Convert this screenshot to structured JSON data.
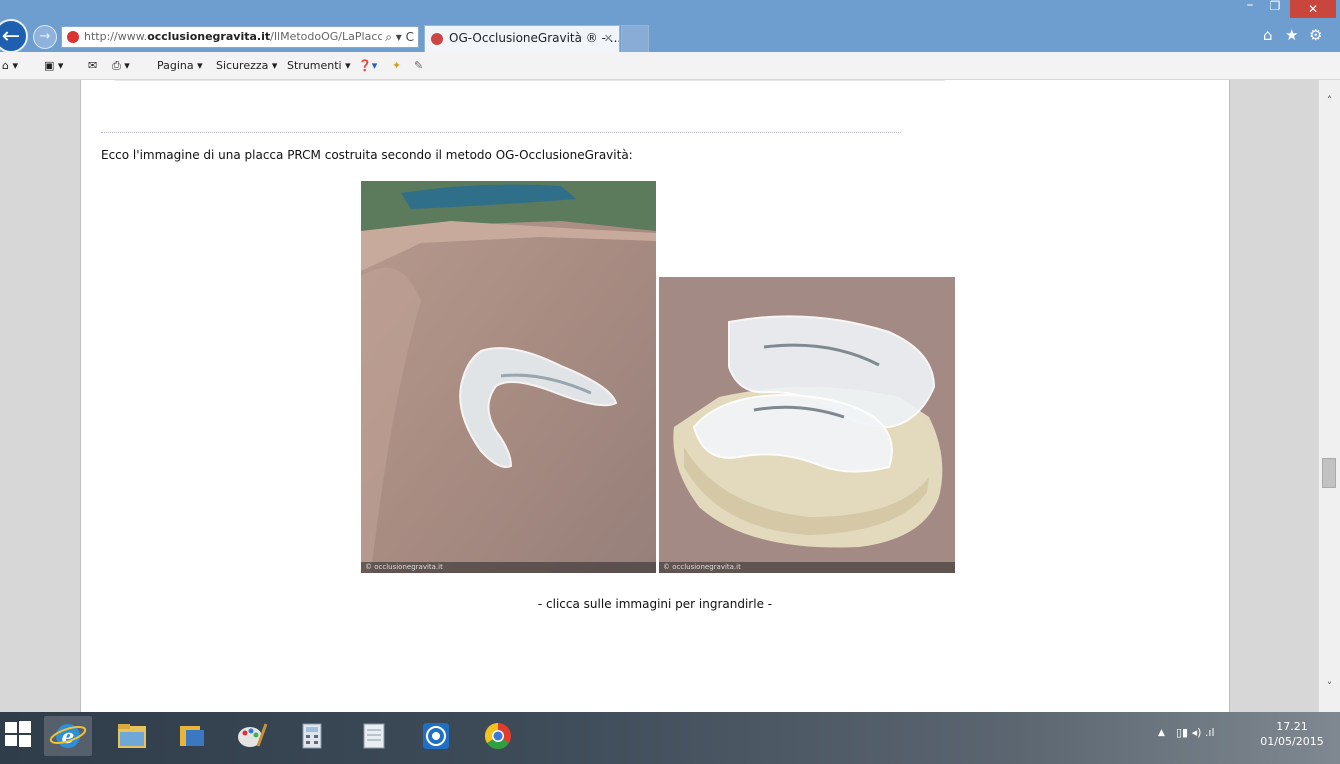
{
  "browser": {
    "address": {
      "prefix": "http://www.",
      "domain": "occlusionegravita.it",
      "path": "/IlMetodoOG/LaPlacc",
      "actions": "⌕ ▾ C"
    },
    "tab": {
      "title": "OG-OcclusioneGravità ® - ...",
      "close": "✕"
    },
    "window": {
      "minimize": "–",
      "maximize": "❐",
      "close": "✕"
    },
    "toolbar": {
      "home": "⌂ ▾",
      "feeds": "▣ ▾",
      "mail": "✉",
      "print": "⎙ ▾",
      "page_menu": "Pagina ▾",
      "safety_menu": "Sicurezza ▾",
      "tools_menu": "Strumenti ▾",
      "help": "❓▾"
    }
  },
  "page": {
    "intro_text": "Ecco l'immagine di una placca PRCM costruita secondo il metodo OG-OcclusioneGravità:",
    "images": [
      {
        "watermark": "© occlusionegravita.it"
      },
      {
        "watermark": "© occlusionegravita.it"
      }
    ],
    "caption": "- clicca sulle immagini per ingrandirle -"
  },
  "scroll": {
    "up": "˄",
    "down": "˅"
  },
  "taskbar": {
    "apps": [
      "internet-explorer",
      "file-explorer",
      "outlook",
      "paint",
      "calculator",
      "notepad",
      "media-center",
      "chrome"
    ],
    "tray": "▯▮  ◂)  .ıl",
    "tray_arrow": "▲",
    "time": "17.21",
    "date": "01/05/2015"
  },
  "colors": {
    "titlebar": "#6e9ecf",
    "close": "#c9463d",
    "page_bg": "#ffffff",
    "rail": "#d7d7d7"
  }
}
